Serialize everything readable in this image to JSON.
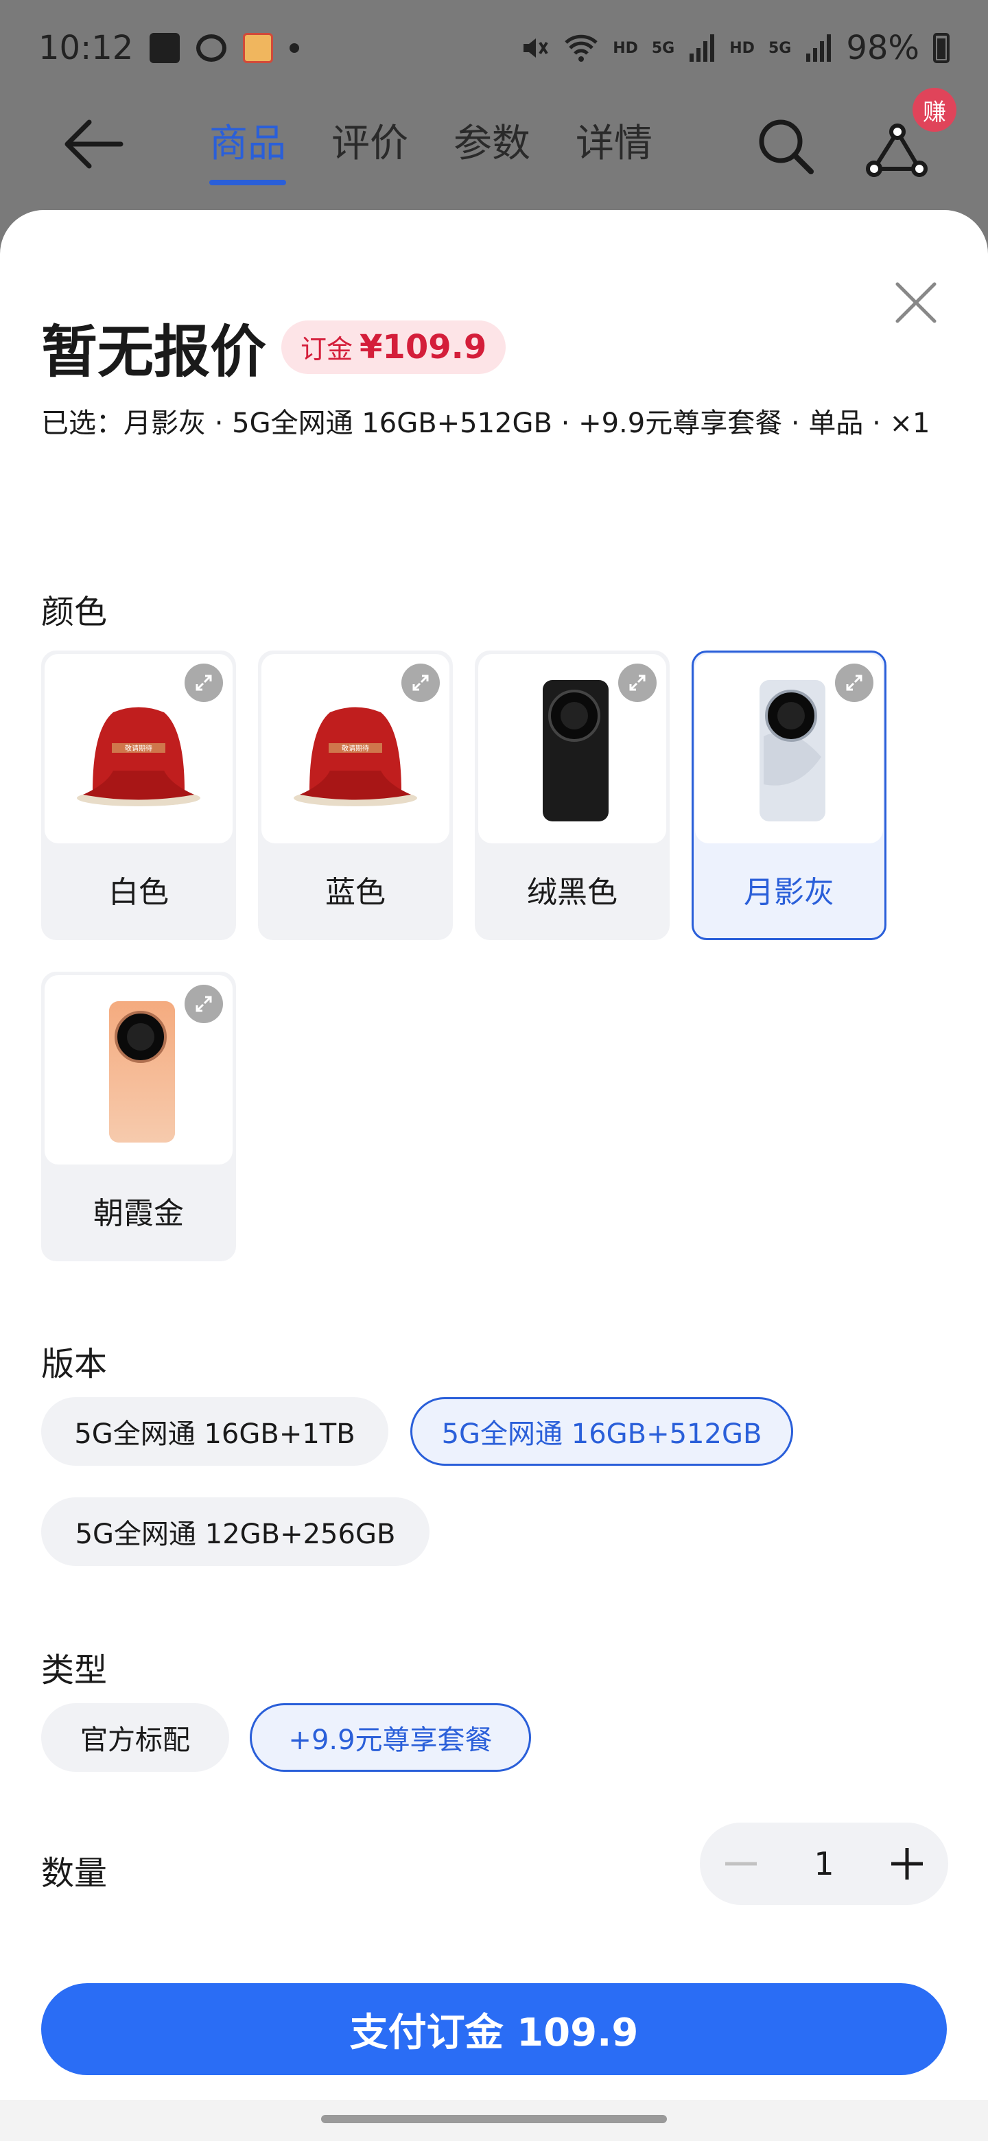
{
  "status_bar": {
    "time": "10:12",
    "network_labels": [
      "HD",
      "5G",
      "HD",
      "5G"
    ],
    "battery": "98%"
  },
  "nav": {
    "tabs": [
      "商品",
      "评价",
      "参数",
      "详情"
    ],
    "active_tab": "商品",
    "earn_badge": "赚"
  },
  "price": {
    "title": "暂无报价",
    "deposit_label": "订金",
    "deposit_value": "¥109.9"
  },
  "selected": {
    "text": "已选：月影灰 · 5G全网通 16GB+512GB · +9.9元尊享套餐 · 单品 · ×1"
  },
  "color_section": {
    "title": "颜色",
    "options": [
      {
        "label": "白色",
        "image": "veiled-product",
        "selected": false
      },
      {
        "label": "蓝色",
        "image": "veiled-product",
        "selected": false
      },
      {
        "label": "绒黑色",
        "image": "black-phone",
        "selected": false
      },
      {
        "label": "月影灰",
        "image": "grey-phone",
        "selected": true
      },
      {
        "label": "朝霞金",
        "image": "gold-phone",
        "selected": false
      }
    ],
    "veil_text": "敬请期待"
  },
  "version_section": {
    "title": "版本",
    "options": [
      {
        "label": "5G全网通 16GB+1TB",
        "selected": false
      },
      {
        "label": "5G全网通 16GB+512GB",
        "selected": true
      },
      {
        "label": "5G全网通 12GB+256GB",
        "selected": false
      }
    ]
  },
  "type_section": {
    "title": "类型",
    "options": [
      {
        "label": "官方标配",
        "selected": false
      },
      {
        "label": "+9.9元尊享套餐",
        "selected": true
      }
    ]
  },
  "quantity": {
    "title": "数量",
    "value": "1"
  },
  "pay_button": {
    "label": "支付订金 109.9"
  },
  "colors": {
    "accent": "#2a5fd9",
    "pay_button": "#2a6df5",
    "deposit_red": "#d41e3a"
  }
}
